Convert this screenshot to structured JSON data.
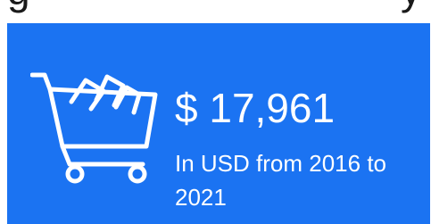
{
  "heading_fragment_left": "g",
  "heading_fragment_right": "y",
  "stat": {
    "icon": "shopping-cart-icon",
    "amount": "$ 17,961",
    "caption": "In USD from 2016 to 2021"
  },
  "colors": {
    "panel": "#1b73f2",
    "text": "#ffffff"
  }
}
